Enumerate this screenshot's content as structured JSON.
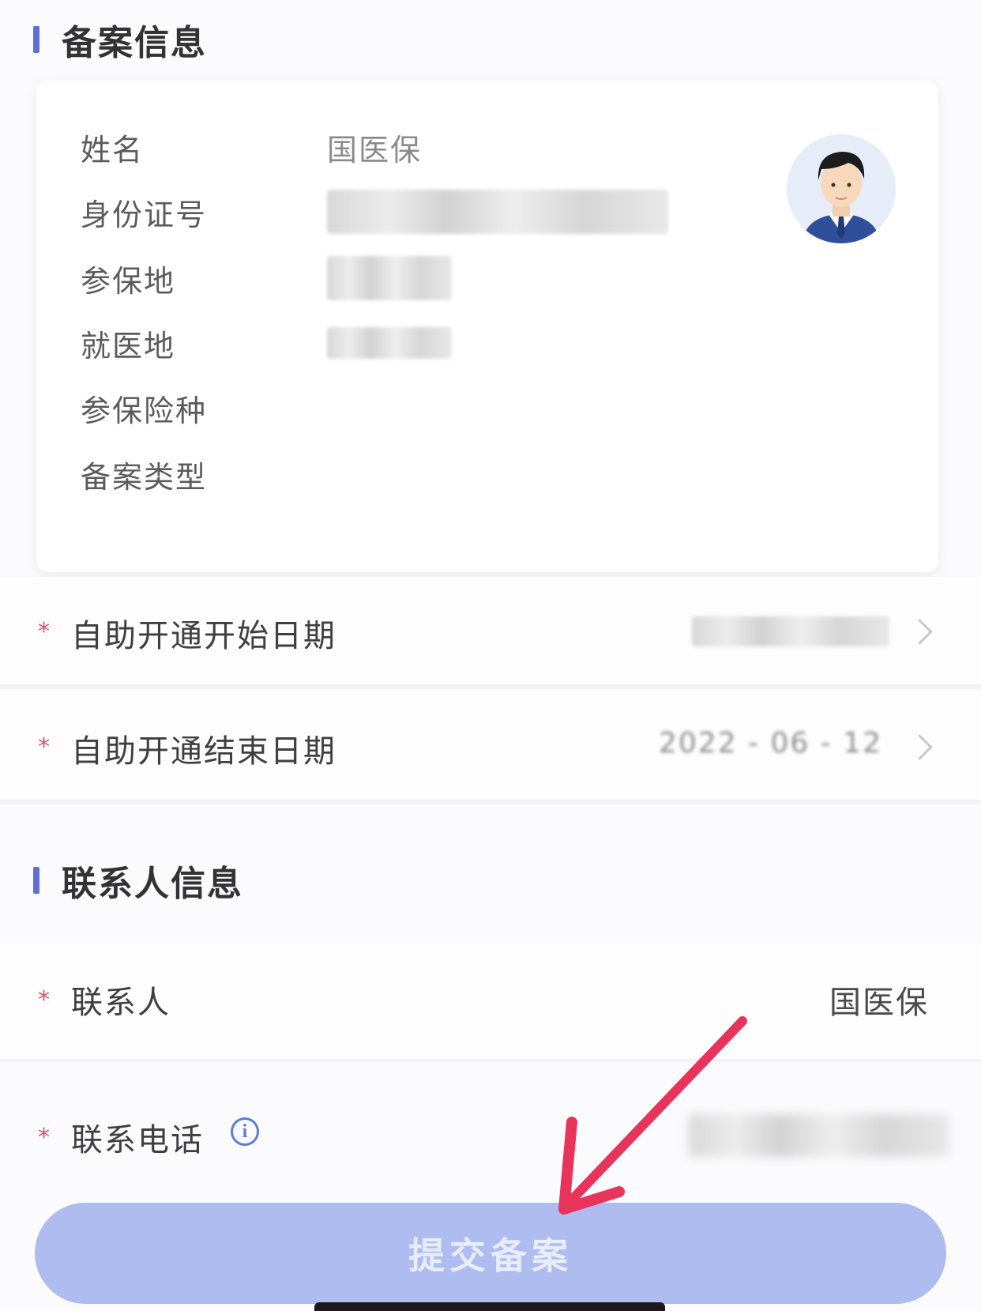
{
  "filing_section": {
    "title": "备案信息",
    "rows": [
      {
        "label": "姓名",
        "value": "国医保"
      },
      {
        "label": "身份证号",
        "value": ""
      },
      {
        "label": "参保地",
        "value": ""
      },
      {
        "label": "就医地",
        "value": ""
      },
      {
        "label": "参保险种",
        "value": ""
      },
      {
        "label": "备案类型",
        "value": ""
      }
    ]
  },
  "dates": {
    "start_label": "自助开通开始日期",
    "end_label": "自助开通结束日期",
    "end_value_partial": "2022 - 06 - 12",
    "required_mark": "*"
  },
  "contact_section": {
    "title": "联系人信息",
    "contact_label": "联系人",
    "contact_value": "国医保",
    "phone_label": "联系电话",
    "info_icon_glyph": "i"
  },
  "submit": {
    "label": "提交备案"
  },
  "colors": {
    "accent": "#5f6fd6",
    "button": "#aebcf0",
    "required": "#d9546a",
    "annotation_arrow": "#e8345a"
  },
  "icons": [
    "avatar-icon",
    "chevron-right-icon",
    "info-icon",
    "annotation-arrow-icon"
  ]
}
